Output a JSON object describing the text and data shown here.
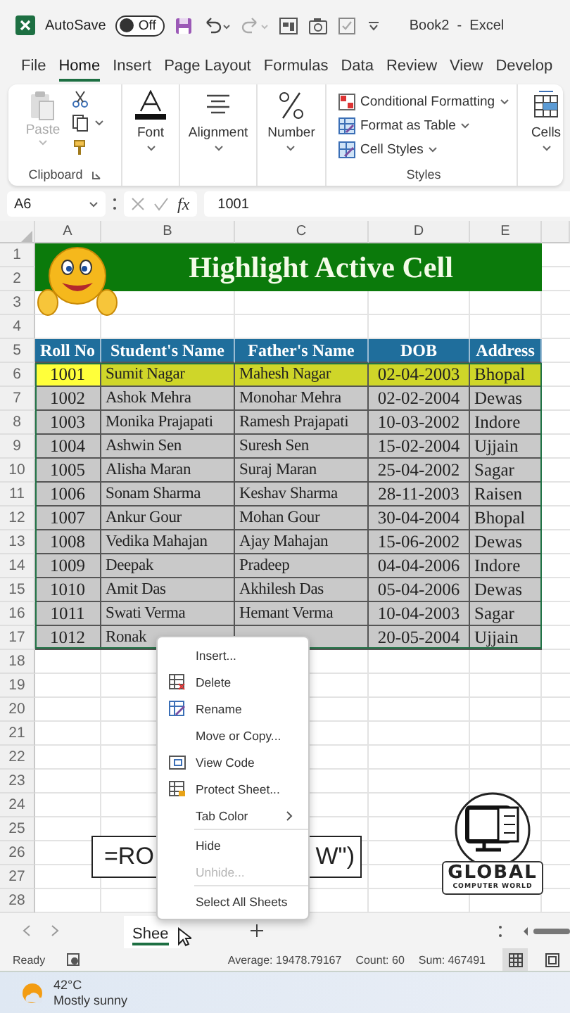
{
  "title_bar": {
    "autosave_label": "AutoSave",
    "autosave": {
      "on": false,
      "label": "Off"
    },
    "title": "Book2  -  Excel"
  },
  "menu_tabs": [
    {
      "label": "File",
      "selected": false
    },
    {
      "label": "Home",
      "selected": true
    },
    {
      "label": "Insert",
      "selected": false
    },
    {
      "label": "Page Layout",
      "selected": false
    },
    {
      "label": "Formulas",
      "selected": false
    },
    {
      "label": "Data",
      "selected": false
    },
    {
      "label": "Review",
      "selected": false
    },
    {
      "label": "View",
      "selected": false
    },
    {
      "label": "Develop",
      "selected": false
    }
  ],
  "ribbon": {
    "clipboard": {
      "paste": {
        "label": "Paste",
        "disabled": true
      },
      "label": "Clipboard"
    },
    "font": {
      "label": "Font"
    },
    "alignment": {
      "label": "Alignment"
    },
    "number": {
      "label": "Number"
    },
    "styles": {
      "items": [
        "Conditional Formatting",
        "Format as Table",
        "Cell Styles"
      ],
      "label": "Styles"
    },
    "cells": {
      "label": "Cells"
    }
  },
  "formula_bar": {
    "name_box": "A6",
    "function_label": "fx",
    "formula": "1001"
  },
  "sheet": {
    "columns": [
      "A",
      "B",
      "C",
      "D",
      "E"
    ],
    "row_numbers": [
      "1",
      "2",
      "3",
      "4",
      "5",
      "6",
      "7",
      "8",
      "9",
      "10",
      "11",
      "12",
      "13",
      "14",
      "15",
      "16",
      "17",
      "18",
      "19",
      "20",
      "21",
      "22",
      "23",
      "24",
      "25",
      "26",
      "27",
      "28"
    ],
    "banner": "Highlight Active Cell",
    "table": {
      "columns": [
        "Roll No",
        "Student's Name",
        "Father's Name",
        "DOB",
        "Address"
      ],
      "rows": [
        {
          "roll": "1001",
          "name": "Sumit Nagar",
          "father": "Mahesh Nagar",
          "dob": "02-04-2003",
          "address": "Bhopal",
          "selected": true
        },
        {
          "roll": "1002",
          "name": "Ashok Mehra",
          "father": "Monohar Mehra",
          "dob": "02-02-2004",
          "address": "Dewas",
          "selected": false
        },
        {
          "roll": "1003",
          "name": "Monika Prajapati",
          "father": "Ramesh Prajapati",
          "dob": "10-03-2002",
          "address": "Indore",
          "selected": false
        },
        {
          "roll": "1004",
          "name": "Ashwin Sen",
          "father": "Suresh Sen",
          "dob": "15-02-2004",
          "address": "Ujjain",
          "selected": false
        },
        {
          "roll": "1005",
          "name": "Alisha Maran",
          "father": "Suraj Maran",
          "dob": "25-04-2002",
          "address": "Sagar",
          "selected": false
        },
        {
          "roll": "1006",
          "name": "Sonam Sharma",
          "father": "Keshav Sharma",
          "dob": "28-11-2003",
          "address": "Raisen",
          "selected": false
        },
        {
          "roll": "1007",
          "name": "Ankur Gour",
          "father": "Mohan Gour",
          "dob": "30-04-2004",
          "address": "Bhopal",
          "selected": false
        },
        {
          "roll": "1008",
          "name": "Vedika Mahajan",
          "father": "Ajay Mahajan",
          "dob": "15-06-2002",
          "address": "Dewas",
          "selected": false
        },
        {
          "roll": "1009",
          "name": "Deepak",
          "father": "Pradeep",
          "dob": "04-04-2006",
          "address": "Indore",
          "selected": false
        },
        {
          "roll": "1010",
          "name": "Amit Das",
          "father": "Akhilesh Das",
          "dob": "05-04-2006",
          "address": "Dewas",
          "selected": false
        },
        {
          "roll": "1011",
          "name": "Swati Verma",
          "father": "Hemant Verma",
          "dob": "10-04-2003",
          "address": "Sagar",
          "selected": false
        },
        {
          "roll": "1012",
          "name": "Ronak",
          "dob": "20-05-2004",
          "address": "Ujjain",
          "selected": false
        }
      ]
    },
    "formula_box": {
      "left": "=RO",
      "right": "W\")"
    },
    "logo": {
      "name": "GLOBAL",
      "tagline": "COMPUTER WORLD"
    }
  },
  "context_menu": [
    {
      "label": "Insert...",
      "kind": "plain",
      "disabled": false,
      "separator_before": false
    },
    {
      "label": "Delete",
      "kind": "delete",
      "disabled": false,
      "separator_before": false
    },
    {
      "label": "Rename",
      "kind": "rename",
      "disabled": false,
      "separator_before": false
    },
    {
      "label": "Move or Copy...",
      "kind": "plain",
      "disabled": false,
      "separator_before": false
    },
    {
      "label": "View Code",
      "kind": "code",
      "disabled": false,
      "separator_before": false
    },
    {
      "label": "Protect Sheet...",
      "kind": "protect",
      "disabled": false,
      "separator_before": false
    },
    {
      "label": "Tab Color",
      "kind": "submenu",
      "disabled": false,
      "separator_before": false
    },
    {
      "label": "Hide",
      "kind": "plain",
      "disabled": false,
      "separator_before": true
    },
    {
      "label": "Unhide...",
      "kind": "plain",
      "disabled": true,
      "separator_before": false
    },
    {
      "label": "Select All Sheets",
      "kind": "plain",
      "disabled": false,
      "separator_before": true
    }
  ],
  "sheet_tabs": [
    {
      "label": "Shee",
      "selected": true
    }
  ],
  "status_bar": {
    "mode": "Ready",
    "average": "Average: 19478.79167",
    "count": "Count: 60",
    "sum": "Sum: 467491",
    "views": [
      {
        "kind": "normal",
        "selected": true
      },
      {
        "kind": "page",
        "selected": false
      }
    ]
  },
  "taskbar": {
    "temperature": "42°C",
    "condition": "Mostly sunny"
  }
}
